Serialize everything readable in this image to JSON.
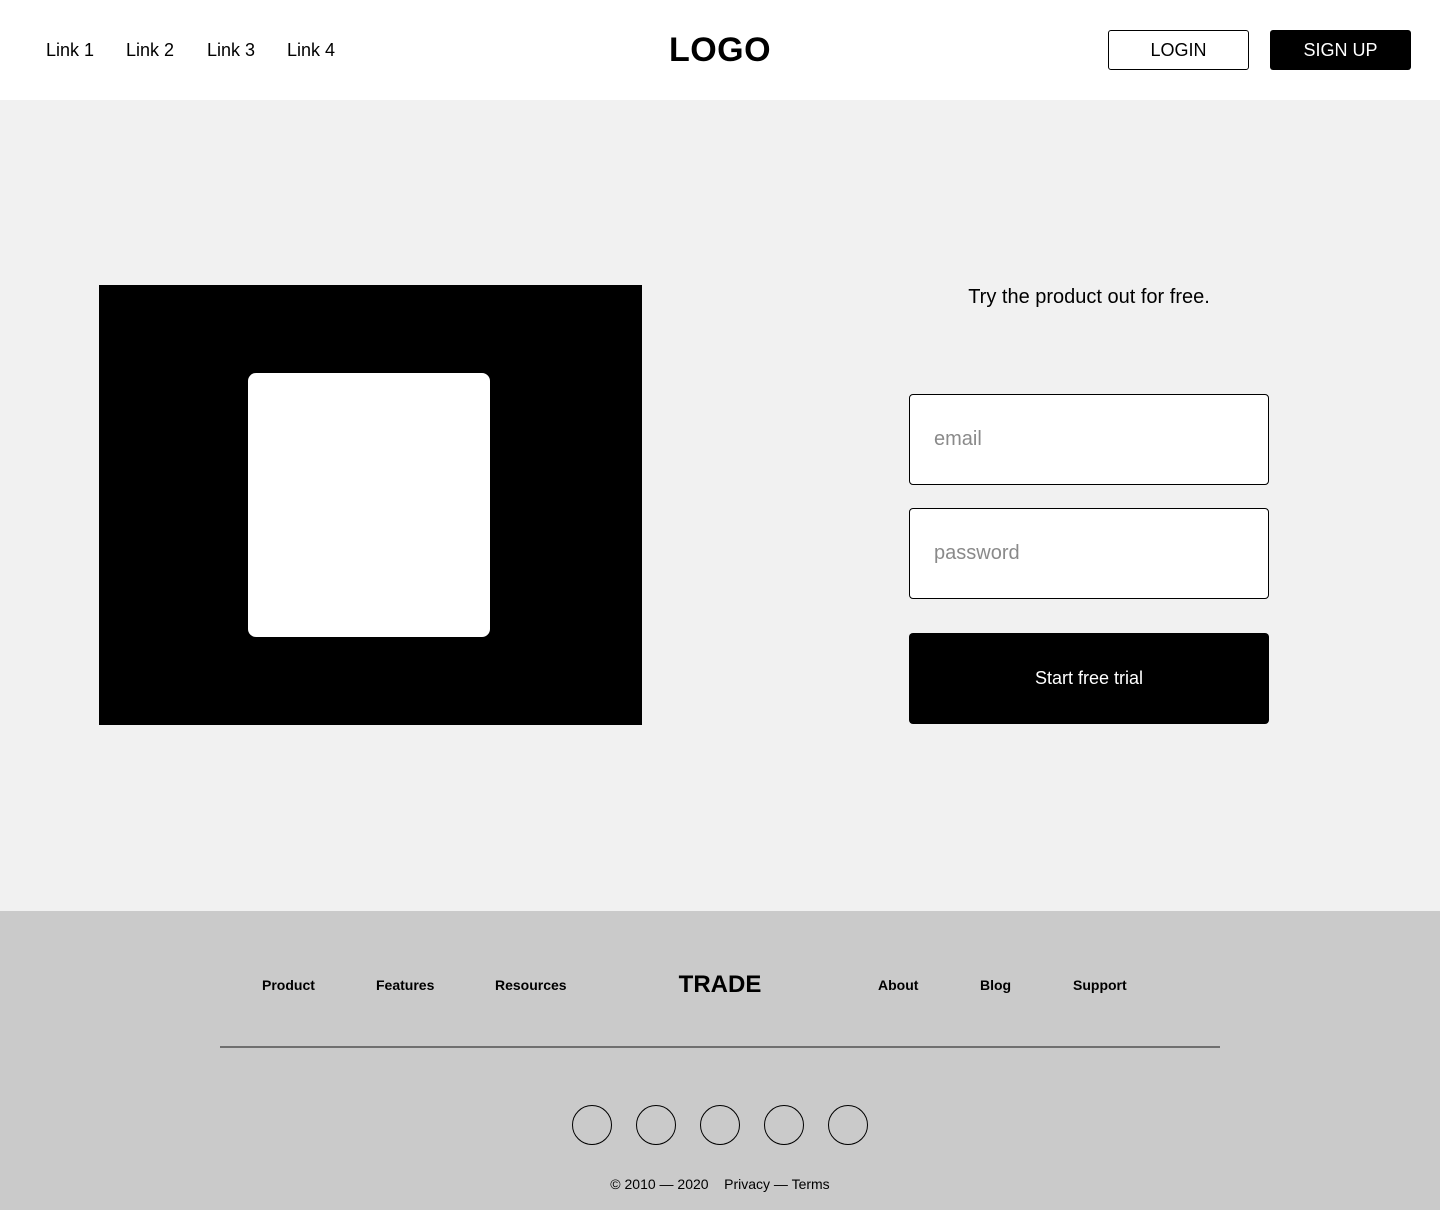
{
  "header": {
    "nav": [
      "Link 1",
      "Link 2",
      "Link 3",
      "Link 4"
    ],
    "logo": "LOGO",
    "login_label": "LOGIN",
    "signup_label": "SIGN UP"
  },
  "hero": {
    "tagline": "Try the product out for free.",
    "email_placeholder": "email",
    "password_placeholder": "password",
    "cta_label": "Start free trial"
  },
  "footer": {
    "links_left": [
      "Product",
      "Features",
      "Resources"
    ],
    "brand": "TRADE",
    "links_right": [
      "About",
      "Blog",
      "Support"
    ],
    "social_icons": [
      "social-icon-1",
      "social-icon-2",
      "social-icon-3",
      "social-icon-4",
      "social-icon-5"
    ],
    "copyright": "© 2010 — 2020",
    "legal_links": "Privacy — Terms"
  },
  "colors": {
    "header_bg": "#ffffff",
    "hero_bg": "#f1f1f1",
    "footer_bg": "#cacaca",
    "primary": "#000000"
  }
}
